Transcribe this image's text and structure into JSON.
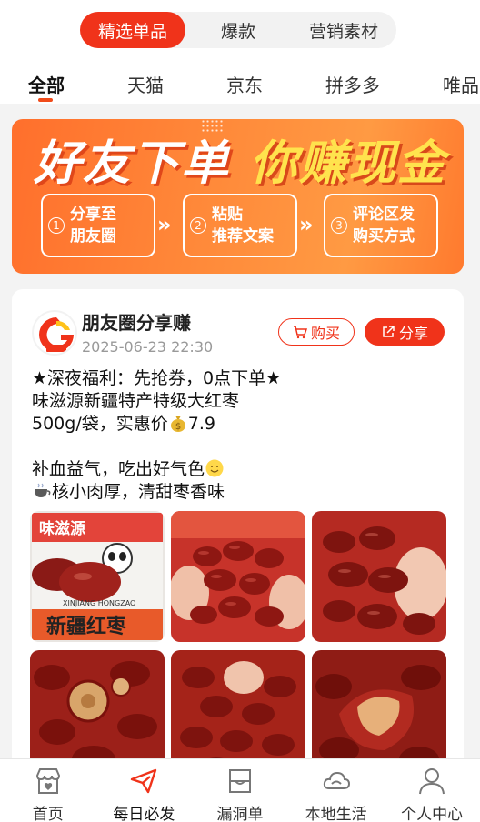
{
  "segment": {
    "items": [
      {
        "label": "精选单品",
        "active": true
      },
      {
        "label": "爆款",
        "active": false
      },
      {
        "label": "营销素材",
        "active": false
      }
    ]
  },
  "platform_tabs": [
    "全部",
    "天猫",
    "京东",
    "拼多多",
    "唯品"
  ],
  "banner": {
    "title_left": "好友下单",
    "title_right": "你赚现金",
    "steps": [
      {
        "num": "1",
        "line1": "分享至",
        "line2": "朋友圈"
      },
      {
        "num": "2",
        "line1": "粘贴",
        "line2": "推荐文案"
      },
      {
        "num": "3",
        "line1": "评论区发",
        "line2": "购买方式"
      }
    ]
  },
  "post": {
    "author": "朋友圈分享赚",
    "time": "2025-06-23 22:30",
    "buy_label": "购买",
    "share_label": "分享",
    "lines": [
      "★深夜福利：先抢券，0点下单★",
      "味滋源新疆特产特级大红枣",
      "500g/袋，实惠价",
      "7.9",
      "补血益气，吃出好气色",
      "核小肉厚，清甜枣香味"
    ],
    "package_text": "味滋源",
    "package_label": "新疆红枣",
    "package_sub": "XINJIANG HONGZAO",
    "image_count": 6
  },
  "colors": {
    "accent": "#f0331a",
    "banner": "#ff8a3a",
    "highlight": "#ffe34d"
  },
  "bottom_nav": [
    {
      "label": "首页",
      "icon": "shop-home-icon",
      "active": false
    },
    {
      "label": "每日必发",
      "icon": "paper-plane-icon",
      "active": true
    },
    {
      "label": "漏洞单",
      "icon": "bag-icon",
      "active": false
    },
    {
      "label": "本地生活",
      "icon": "cloud-icon",
      "active": false
    },
    {
      "label": "个人中心",
      "icon": "user-icon",
      "active": false
    }
  ]
}
